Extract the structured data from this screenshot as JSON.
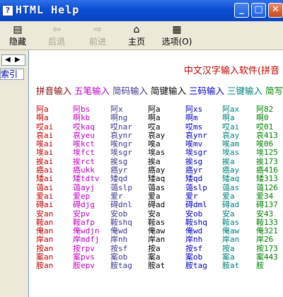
{
  "window": {
    "title": "HTML Help"
  },
  "toolbar": {
    "hide": "隐藏",
    "back": "后退",
    "forward": "前进",
    "home": "主页",
    "options": "选项(O)"
  },
  "nav": {
    "tab_label": "索引"
  },
  "content": {
    "heading": "中文汉字输入软件(拼音",
    "methods": [
      "拼音输入",
      "五笔输入",
      "简码输入",
      "简键输入",
      "三码输入",
      "三键输入",
      "简写"
    ],
    "rows": [
      [
        "阿a",
        "阿bs",
        "阿x",
        "阿a",
        "阿xs",
        "阿ax",
        "阿82"
      ],
      [
        "啊a",
        "啊kb",
        "啊ng",
        "啊a",
        "啊m",
        "啊a",
        "啊0"
      ],
      [
        "哎ai",
        "哎kaq",
        "哎nar",
        "哎a",
        "哎ms",
        "哎ai",
        "哎01"
      ],
      [
        "哀ai",
        "哀yeu",
        "哀ynr",
        "哀ay",
        "哀ynr",
        "哀ay",
        "哀413"
      ],
      [
        "唉ai",
        "唉kct",
        "唉ngr",
        "唉a",
        "唉mv",
        "唉am",
        "唉06"
      ],
      [
        "埃ai",
        "埃fct",
        "埃sgr",
        "埃as",
        "埃sgr",
        "埃as",
        "埃125"
      ],
      [
        "挨ai",
        "挨rct",
        "挨sg",
        "挨a",
        "挨sg",
        "挨a",
        "挨173"
      ],
      [
        "癌ai",
        "癌ukk",
        "癌yr",
        "癌ay",
        "癌yr",
        "癌ay",
        "癌416"
      ],
      [
        "矮ai",
        "矮tdtv",
        "矮qd",
        "矮aq",
        "矮qd",
        "矮aq",
        "矮313"
      ],
      [
        "蔼ai",
        "蔼ayj",
        "蔼slp",
        "蔼as",
        "蔼slp",
        "蔼as",
        "蔼126"
      ],
      [
        "爱ai",
        "爱ep",
        "爱r",
        "爱a",
        "爱r",
        "爱a",
        "爱34"
      ],
      [
        "碍ai",
        "碍djg",
        "碍dnl",
        "碍ad",
        "碍dml",
        "碍ad",
        "碍137"
      ],
      [
        "安an",
        "安pv",
        "安ob",
        "安a",
        "安ob",
        "安a",
        "安43"
      ],
      [
        "鞍an",
        "鞍afp",
        "鞍shq",
        "鞍as",
        "鞍shq",
        "鞍as",
        "鞍133"
      ],
      [
        "俺an",
        "俺wdjn",
        "俺wd",
        "俺aw",
        "俺wd",
        "俺aw",
        "俺321"
      ],
      [
        "岸an",
        "岸mdfj",
        "岸nh",
        "岸an",
        "岸nh",
        "岸an",
        "岸26"
      ],
      [
        "按an",
        "按rpv",
        "按sf",
        "按a",
        "按sf",
        "按a",
        "按173"
      ],
      [
        "案an",
        "案pvs",
        "案ob",
        "案a",
        "案ob",
        "案a",
        "案443"
      ],
      [
        "胺an",
        "胺epv",
        "胺tag",
        "胺at",
        "胺tag",
        "胺at",
        "胺"
      ]
    ]
  }
}
